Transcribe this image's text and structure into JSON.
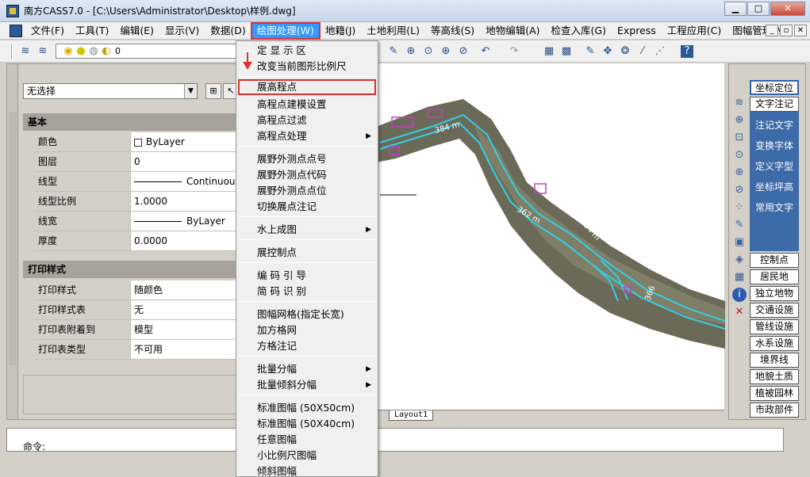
{
  "window": {
    "title": "南方CASS7.0 - [C:\\Users\\Administrator\\Desktop\\样例.dwg]",
    "min_glyph": "▁",
    "max_glyph": "□",
    "close_glyph": "✕"
  },
  "menubar": {
    "items": [
      "文件(F)",
      "工具(T)",
      "编辑(E)",
      "显示(V)",
      "数据(D)",
      "绘图处理(W)",
      "地籍(J)",
      "土地利用(L)",
      "等高线(S)",
      "地物编辑(A)",
      "检查入库(G)",
      "Express",
      "工程应用(C)",
      "图幅管理(M)"
    ],
    "mdi_buttons": [
      "_",
      "▫",
      "✕"
    ]
  },
  "toolbar": {
    "layer_name": "0"
  },
  "properties": {
    "selection": "无选择",
    "sections": {
      "basic": "基本",
      "plot": "打印样式"
    },
    "basic_rows": [
      {
        "label": "颜色",
        "value": "ByLayer"
      },
      {
        "label": "图层",
        "value": "0"
      },
      {
        "label": "线型",
        "value": "Continuous"
      },
      {
        "label": "线型比例",
        "value": "1.0000"
      },
      {
        "label": "线宽",
        "value": "ByLayer"
      },
      {
        "label": "厚度",
        "value": "0.0000"
      }
    ],
    "plot_rows": [
      {
        "label": "打印样式",
        "value": "随颜色"
      },
      {
        "label": "打印样式表",
        "value": "无"
      },
      {
        "label": "打印表附着到",
        "value": "模型"
      },
      {
        "label": "打印表类型",
        "value": "不可用"
      }
    ]
  },
  "canvas": {
    "labels": [
      "384 m",
      "362 m",
      "364 m",
      "366"
    ],
    "tab": "Layout1"
  },
  "dropdown": {
    "items": [
      {
        "label": "定 显 示 区",
        "arrow": false
      },
      {
        "label": "改变当前图形比例尺",
        "arrow": false
      },
      {
        "label": "展高程点",
        "arrow": false,
        "highlighted": true
      },
      {
        "label": "高程点建模设置",
        "arrow": false
      },
      {
        "label": "高程点过滤",
        "arrow": false
      },
      {
        "label": "高程点处理",
        "arrow": true
      },
      {
        "label": "展野外测点点号",
        "arrow": false
      },
      {
        "label": "展野外测点代码",
        "arrow": false
      },
      {
        "label": "展野外测点点位",
        "arrow": false
      },
      {
        "label": "切换展点注记",
        "arrow": false
      },
      {
        "label": "水上成图",
        "arrow": true
      },
      {
        "label": "展控制点",
        "arrow": false
      },
      {
        "label": "编 码 引 导",
        "arrow": false
      },
      {
        "label": "简 码 识 别",
        "arrow": false
      },
      {
        "label": "图幅网格(指定长宽)",
        "arrow": false
      },
      {
        "label": "加方格网",
        "arrow": false
      },
      {
        "label": "方格注记",
        "arrow": false
      },
      {
        "label": "批量分幅",
        "arrow": true
      },
      {
        "label": "批量倾斜分幅",
        "arrow": true
      },
      {
        "label": "标准图幅 (50X50cm)",
        "arrow": false
      },
      {
        "label": "标准图幅 (50X40cm)",
        "arrow": false
      },
      {
        "label": "任意图幅",
        "arrow": false
      },
      {
        "label": "小比例尺图幅",
        "arrow": false
      },
      {
        "label": "倾斜图幅",
        "arrow": false
      }
    ],
    "arrow_glyph": "▶"
  },
  "right_panel": {
    "top_buttons": [
      "坐标定位",
      "文字注记"
    ],
    "blue_items": [
      "注记文字",
      "变换字体",
      "定义字型",
      "坐标坪高",
      "常用文字"
    ],
    "bottom_buttons": [
      "控制点",
      "居民地",
      "独立地物",
      "交通设施",
      "管线设施",
      "水系设施",
      "境界线",
      "地貌土质",
      "植被园林",
      "市政部件"
    ]
  },
  "command": {
    "prompt": "命令:"
  },
  "colors": {
    "menu_highlight": "#3399ff",
    "annotation_red": "#e03030",
    "river_cyan": "#30d0e8",
    "panel_blue": "#3d6aa8"
  }
}
